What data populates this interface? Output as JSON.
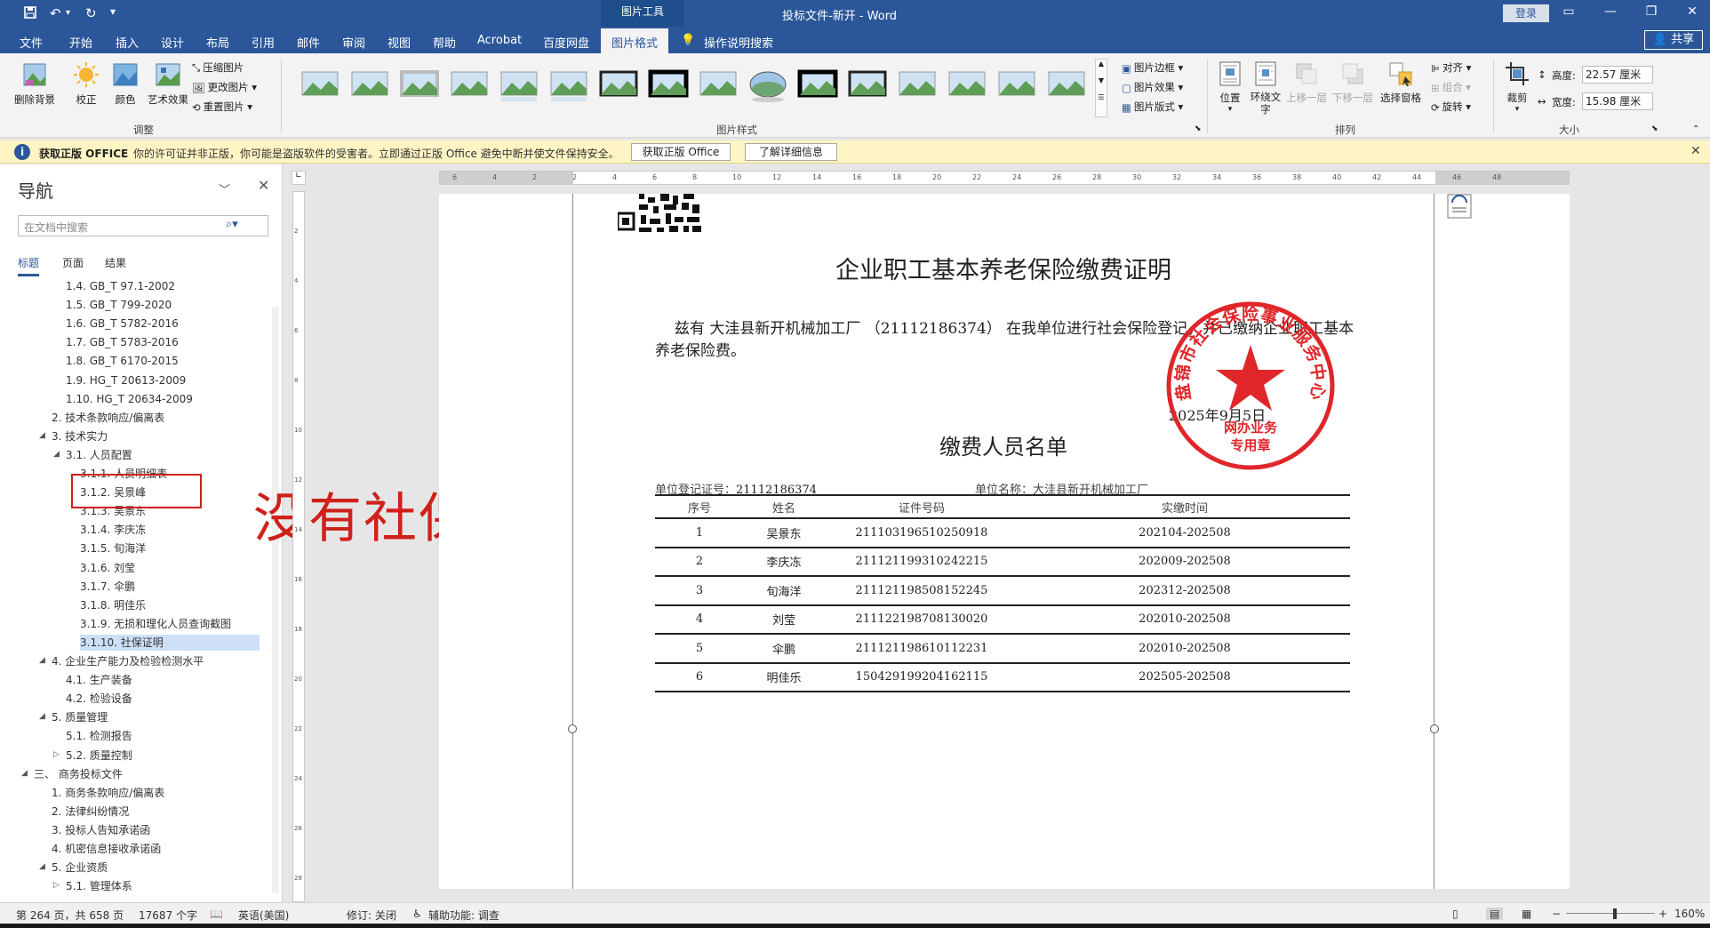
{
  "window": {
    "title": "投标文件-新开  -  Word",
    "context_tab_group": "图片工具",
    "login_label": "登录",
    "qa_save_icon": "save-icon",
    "qa_undo_icon": "undo-icon",
    "qa_redo_icon": "redo-icon"
  },
  "tabs": [
    "文件",
    "开始",
    "插入",
    "设计",
    "布局",
    "引用",
    "邮件",
    "审阅",
    "视图",
    "帮助",
    "Acrobat",
    "百度网盘",
    "图片格式"
  ],
  "active_tab": "图片格式",
  "tell_me": "操作说明搜索",
  "share_label": "共享",
  "ribbon": {
    "remove_bg": "删除背景",
    "corrections": "校正",
    "color": "颜色",
    "artistic": "艺术效果",
    "compress": "压缩图片",
    "change_picture": "更改图片",
    "reset_picture": "重置图片",
    "group_adjust": "调整",
    "group_styles": "图片样式",
    "picture_border": "图片边框",
    "picture_effects": "图片效果",
    "picture_layout": "图片版式",
    "position": "位置",
    "wrap_text": "环绕文字",
    "bring_forward": "上移一层",
    "send_backward": "下移一层",
    "selection_pane": "选择窗格",
    "align": "对齐",
    "group": "组合",
    "rotate": "旋转",
    "group_arrange": "排列",
    "crop": "裁剪",
    "height_label": "高度:",
    "height_value": "22.57 厘米",
    "width_label": "宽度:",
    "width_value": "15.98 厘米",
    "group_size": "大小"
  },
  "message_bar": {
    "title": "获取正版 OFFICE",
    "text": "你的许可证并非正版，你可能是盗版软件的受害者。立即通过正版 Office 避免中断并使文件保持安全。",
    "button_genuine": "获取正版 Office",
    "button_learn": "了解详细信息"
  },
  "nav": {
    "title": "导航",
    "search_placeholder": "在文档中搜索",
    "tabs": [
      "标题",
      "页面",
      "结果"
    ],
    "items": [
      {
        "label": "1.4. GB_T 97.1-2002",
        "level": 3
      },
      {
        "label": "1.5. GB_T 799-2020",
        "level": 3
      },
      {
        "label": "1.6. GB_T 5782-2016",
        "level": 3
      },
      {
        "label": "1.7. GB_T 5783-2016",
        "level": 3
      },
      {
        "label": "1.8. GB_T 6170-2015",
        "level": 3
      },
      {
        "label": "1.9. HG_T 20613-2009",
        "level": 3
      },
      {
        "label": "1.10. HG_T 20634-2009",
        "level": 3
      },
      {
        "label": "2. 技术条款响应/偏离表",
        "level": 2
      },
      {
        "label": "3. 技术实力",
        "level": 2,
        "arrow": "expanded"
      },
      {
        "label": "3.1. 人员配置",
        "level": 3,
        "arrow": "expanded"
      },
      {
        "label": "3.1.1. 人员明细表",
        "level": 4
      },
      {
        "label": "3.1.2. 吴景峰",
        "level": 4
      },
      {
        "label": "3.1.3. 吴景东",
        "level": 4
      },
      {
        "label": "3.1.4. 李庆冻",
        "level": 4
      },
      {
        "label": "3.1.5. 旬海洋",
        "level": 4
      },
      {
        "label": "3.1.6. 刘莹",
        "level": 4
      },
      {
        "label": "3.1.7. 伞鹏",
        "level": 4
      },
      {
        "label": "3.1.8. 明佳乐",
        "level": 4
      },
      {
        "label": "3.1.9. 无损和理化人员查询截图",
        "level": 4
      },
      {
        "label": "3.1.10. 社保证明",
        "level": 4,
        "selected": true
      },
      {
        "label": "4. 企业生产能力及检验检测水平",
        "level": 2,
        "arrow": "expanded"
      },
      {
        "label": "4.1. 生产装备",
        "level": 3
      },
      {
        "label": "4.2. 检验设备",
        "level": 3
      },
      {
        "label": "5. 质量管理",
        "level": 2,
        "arrow": "expanded"
      },
      {
        "label": "5.1. 检测报告",
        "level": 3
      },
      {
        "label": "5.2. 质量控制",
        "level": 3,
        "arrow": "collapsed"
      },
      {
        "label": "三、 商务投标文件",
        "level": 1,
        "arrow": "expanded"
      },
      {
        "label": "1. 商务条款响应/偏离表",
        "level": 2
      },
      {
        "label": "2. 法律纠纷情况",
        "level": 2
      },
      {
        "label": "3. 投标人告知承诺函",
        "level": 2
      },
      {
        "label": "4. 机密信息接收承诺函",
        "level": 2
      },
      {
        "label": "5. 企业资质",
        "level": 2,
        "arrow": "expanded"
      },
      {
        "label": "5.1. 管理体系",
        "level": 3,
        "arrow": "collapsed"
      }
    ]
  },
  "annotation": {
    "text": "没有社保",
    "color": "#d0201a"
  },
  "ruler": {
    "h_ticks": [
      "6",
      "4",
      "2",
      "2",
      "4",
      "6",
      "8",
      "10",
      "12",
      "14",
      "16",
      "18",
      "20",
      "22",
      "24",
      "26",
      "28",
      "30",
      "32",
      "34",
      "36",
      "38",
      "40",
      "42",
      "44",
      "46",
      "48"
    ],
    "v_ticks": [
      "2",
      "4",
      "6",
      "8",
      "10",
      "12",
      "14",
      "16",
      "18",
      "20",
      "22",
      "24",
      "26",
      "28"
    ]
  },
  "document": {
    "cert_title": "企业职工基本养老保险缴费证明",
    "cert_body": "兹有 大洼县新开机械加工厂 （21112186374） 在我单位进行社会保险登记，并已缴纳企业职工基本养老保险费。",
    "cert_date": "2025年9月5日",
    "list_title": "缴费人员名单",
    "reg_no_label": "单位登记证号：",
    "reg_no": "21112186374",
    "unit_name_label": "单位名称：",
    "unit_name": "大洼县新开机械加工厂",
    "table_headers": [
      "序号",
      "姓名",
      "证件号码",
      "实缴时间"
    ],
    "table_rows": [
      [
        "1",
        "吴景东",
        "211103196510250918",
        "202104-202508"
      ],
      [
        "2",
        "李庆冻",
        "211121199310242215",
        "202009-202508"
      ],
      [
        "3",
        "旬海洋",
        "211121198508152245",
        "202312-202508"
      ],
      [
        "4",
        "刘莹",
        "211122198708130020",
        "202010-202508"
      ],
      [
        "5",
        "伞鹏",
        "211121198610112231",
        "202010-202508"
      ],
      [
        "6",
        "明佳乐",
        "150429199204162115",
        "202505-202508"
      ]
    ],
    "stamp_top_text": "盘锦市社会保险事业服务中心",
    "stamp_line1": "网办业务",
    "stamp_line2": "专用章",
    "stamp_color": "#e0262a"
  },
  "status": {
    "page": "第 264 页，共 658 页",
    "words": "17687 个字",
    "language": "英语(美国)",
    "track_changes": "修订: 关闭",
    "accessibility": "辅助功能: 调查",
    "zoom": "160%"
  },
  "colors": {
    "accent": "#2b579a",
    "message_bar": "#fff4c4",
    "nav_selected": "#cde0f7"
  }
}
